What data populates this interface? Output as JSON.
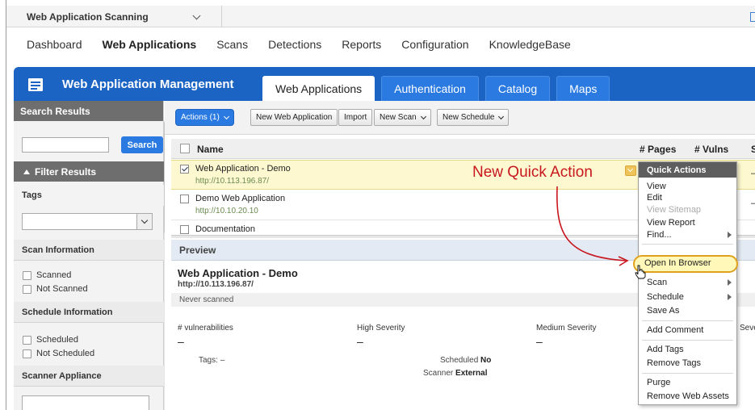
{
  "app_switcher": {
    "label": "Web Application Scanning"
  },
  "main_nav": [
    "Dashboard",
    "Web Applications",
    "Scans",
    "Detections",
    "Reports",
    "Configuration",
    "KnowledgeBase"
  ],
  "module": {
    "title": "Web Application Management",
    "tabs": [
      "Web Applications",
      "Authentication",
      "Catalog",
      "Maps"
    ]
  },
  "sidebar": {
    "search_header": "Search Results",
    "search_button": "Search",
    "filter_header": "Filter Results",
    "tags_label": "Tags",
    "scan_info": {
      "title": "Scan Information",
      "options": [
        "Scanned",
        "Not Scanned"
      ]
    },
    "schedule_info": {
      "title": "Schedule Information",
      "options": [
        "Scheduled",
        "Not Scheduled"
      ]
    },
    "scanner_title": "Scanner Appliance"
  },
  "toolbar": {
    "actions": "Actions (1)",
    "new_web_app": "New Web Application",
    "import": "Import",
    "new_scan": "New Scan",
    "new_schedule": "New Schedule"
  },
  "grid": {
    "headers": {
      "name": "Name",
      "pages": "# Pages",
      "vulns": "# Vulns",
      "s": "S"
    },
    "rows": [
      {
        "name": "Web Application - Demo",
        "url": "http://10.113.196.87/",
        "dash": "–"
      },
      {
        "name": "Demo Web Application",
        "url": "http://10.10.20.10",
        "dash": "–"
      },
      {
        "name": "Documentation",
        "url": "",
        "dash": ""
      }
    ]
  },
  "preview": {
    "header": "Preview",
    "title": "Web Application - Demo",
    "url": "http://10.113.196.87/",
    "status": "Never scanned",
    "metrics": [
      {
        "label": "# vulnerabilities",
        "value": "–"
      },
      {
        "label": "High Severity",
        "value": "–"
      },
      {
        "label": "Medium Severity",
        "value": "–"
      },
      {
        "label": "Seve",
        "value": ""
      }
    ],
    "tags_label": "Tags:",
    "tags_value": "–",
    "scheduled_label": "Scheduled",
    "scheduled_value": "No",
    "scanner_label": "Scanner",
    "scanner_value": "External"
  },
  "quick_actions": {
    "title": "Quick Actions",
    "items": [
      "View",
      "Edit",
      "View Sitemap",
      "View Report",
      "Find...",
      "Open In Browser",
      "Scan",
      "Schedule",
      "Save As",
      "Add Comment",
      "Add Tags",
      "Remove Tags",
      "Purge",
      "Remove Web Assets"
    ]
  },
  "annotation": {
    "text": "New Quick Action"
  },
  "colors": {
    "brand_blue": "#1c64c4",
    "tab_blue": "#2a7ae2",
    "annotation_red": "#c8171f",
    "highlight": "#fff8b8"
  }
}
